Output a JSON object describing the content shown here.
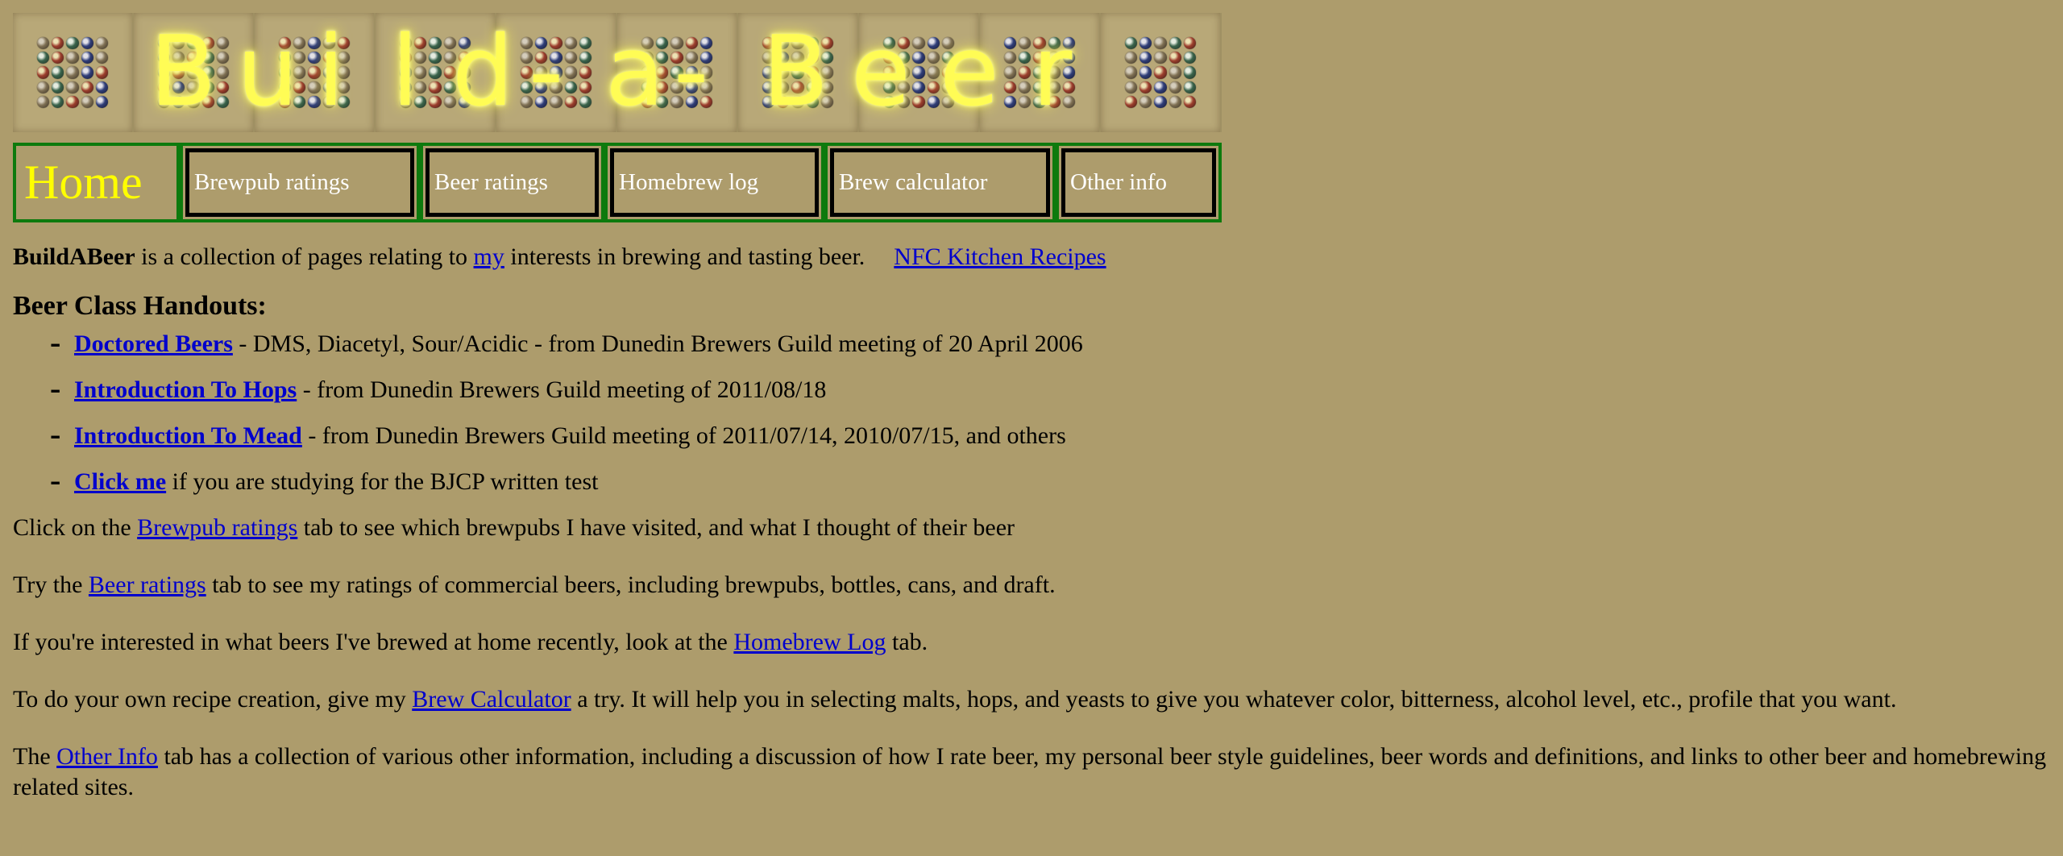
{
  "banner": {
    "letters": [
      "B",
      "u",
      "i",
      "l",
      "d",
      "-",
      "a",
      "-",
      "B",
      "e",
      "e",
      "r"
    ]
  },
  "nav": {
    "home": "Home",
    "tabs": [
      {
        "label": "Brewpub ratings"
      },
      {
        "label": "Beer ratings"
      },
      {
        "label": "Homebrew log"
      },
      {
        "label": "Brew calculator"
      },
      {
        "label": "Other info"
      }
    ]
  },
  "intro": {
    "bold": "BuildABeer",
    "text1": " is a collection of pages relating to ",
    "link_my": "my",
    "text2": " interests in brewing and tasting beer.",
    "link_nfc": "NFC Kitchen Recipes"
  },
  "handouts": {
    "heading": "Beer Class Handouts:",
    "bullet": "-",
    "items": [
      {
        "link": "Doctored Beers",
        "text": " - DMS, Diacetyl, Sour/Acidic - from Dunedin Brewers Guild meeting of 20 April 2006"
      },
      {
        "link": "Introduction To Hops",
        "text": " - from Dunedin Brewers Guild meeting of 2011/08/18"
      },
      {
        "link": "Introduction To Mead",
        "text": " - from Dunedin Brewers Guild meeting of 2011/07/14, 2010/07/15, and others"
      },
      {
        "link": "Click me",
        "text": " if you are studying for the BJCP written test"
      }
    ]
  },
  "paragraphs": [
    {
      "before": "Click on the ",
      "link": "Brewpub ratings",
      "after": " tab to see which brewpubs I have visited, and what I thought of their beer"
    },
    {
      "before": "Try the ",
      "link": "Beer ratings",
      "after": " tab to see my ratings of commercial beers, including brewpubs, bottles, cans, and draft."
    },
    {
      "before": "If you're interested in what beers I've brewed at home recently, look at the ",
      "link": "Homebrew Log",
      "after": " tab."
    },
    {
      "before": "To do your own recipe creation, give my ",
      "link": "Brew Calculator",
      "after": " a try. It will help you in selecting malts, hops, and yeasts to give you whatever color, bitterness, alcohol level, etc., profile that you want."
    },
    {
      "before": "The ",
      "link": "Other Info",
      "after": " tab has a collection of various other information, including a discussion of how I rate beer, my personal beer style guidelines, beer words and definitions, and links to other beer and homebrewing related sites."
    }
  ],
  "colors": {
    "background": "#ad9c6c",
    "link": "#0000cc",
    "home_text": "#ffff00",
    "tab_border": "#0d7a0d",
    "banner_glow": "#fffc55"
  }
}
